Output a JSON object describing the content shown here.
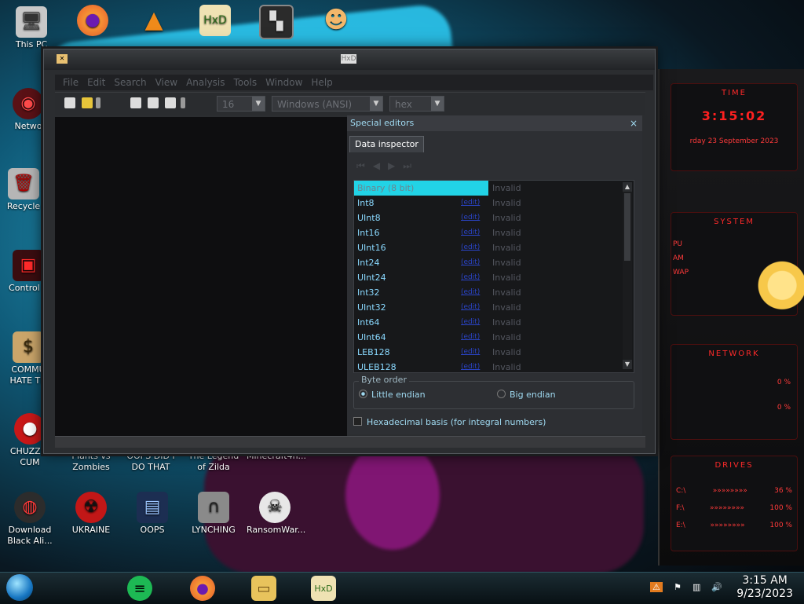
{
  "desktop": {
    "icons": [
      {
        "label": "This PC",
        "icon": "pc-icon"
      },
      {
        "label": "Netwo",
        "icon": "network-icon"
      },
      {
        "label": "Recycle",
        "icon": "recycle-bin-icon"
      },
      {
        "label": "Control P",
        "icon": "control-panel-icon"
      },
      {
        "label": "COMMU HATE TH",
        "icon": "money-bag-icon"
      },
      {
        "label": "CHUZZIN CUM",
        "icon": "chuzzle-icon"
      },
      {
        "label": "Plants vs Zombies",
        "icon": "game-icon"
      },
      {
        "label": "OOPS DID I DO THAT",
        "icon": "game-icon"
      },
      {
        "label": "The Legend of Zilda",
        "icon": "game-icon"
      },
      {
        "label": "Minecraft4n...",
        "icon": "game-icon"
      },
      {
        "label": "Download Black Ali...",
        "icon": "alien-icon"
      },
      {
        "label": "UKRAINE",
        "icon": "radiation-icon"
      },
      {
        "label": "OOPS",
        "icon": "oops-icon"
      },
      {
        "label": "LYNCHING",
        "icon": "lynching-icon"
      },
      {
        "label": "RansomWar...",
        "icon": "skull-icon"
      }
    ],
    "top_icons": [
      "firefox-icon",
      "vlc-icon",
      "hxd-icon",
      "app-icon",
      "user-icon"
    ]
  },
  "window": {
    "title": "HxD",
    "menu": [
      "File",
      "Edit",
      "Search",
      "View",
      "Analysis",
      "Tools",
      "Window",
      "Help"
    ],
    "toolbar": {
      "bytes_per_row": "16",
      "charset": "Windows (ANSI)",
      "offset_base": "hex"
    }
  },
  "special_editors": {
    "title": "Special editors",
    "close": "×",
    "tab": "Data inspector",
    "rows": [
      {
        "name": "Binary (8 bit)",
        "value": "Invalid",
        "selected": true
      },
      {
        "name": "Int8",
        "value": "Invalid"
      },
      {
        "name": "UInt8",
        "value": "Invalid"
      },
      {
        "name": "Int16",
        "value": "Invalid"
      },
      {
        "name": "UInt16",
        "value": "Invalid"
      },
      {
        "name": "Int24",
        "value": "Invalid"
      },
      {
        "name": "UInt24",
        "value": "Invalid"
      },
      {
        "name": "Int32",
        "value": "Invalid"
      },
      {
        "name": "UInt32",
        "value": "Invalid"
      },
      {
        "name": "Int64",
        "value": "Invalid"
      },
      {
        "name": "UInt64",
        "value": "Invalid"
      },
      {
        "name": "LEB128",
        "value": "Invalid"
      },
      {
        "name": "ULEB128",
        "value": "Invalid"
      }
    ],
    "row_edit_link": "(edit)",
    "byte_order": {
      "legend": "Byte order",
      "little": "Little endian",
      "big": "Big endian",
      "selected": "little"
    },
    "hex_basis_label": "Hexadecimal basis (for integral numbers)"
  },
  "gadget": {
    "time_label": "TIME",
    "time_value": "3:15:02",
    "date_text": "rday 23 September 2023",
    "system_label": "SYSTEM",
    "system_rows": [
      "PU",
      "AM",
      "WAP"
    ],
    "network_label": "NETWORK",
    "network_values": [
      "0 %",
      "0 %"
    ],
    "drives_label": "DRIVES",
    "drives": [
      {
        "letter": "C:\\",
        "value": "36 %"
      },
      {
        "letter": "F:\\",
        "value": "100 %"
      },
      {
        "letter": "E:\\",
        "value": "100 %"
      }
    ]
  },
  "taskbar": {
    "apps": [
      "spotify-icon",
      "firefox-icon",
      "file-explorer-icon",
      "hxd-icon"
    ],
    "time": "3:15 AM",
    "date": "9/23/2023"
  }
}
